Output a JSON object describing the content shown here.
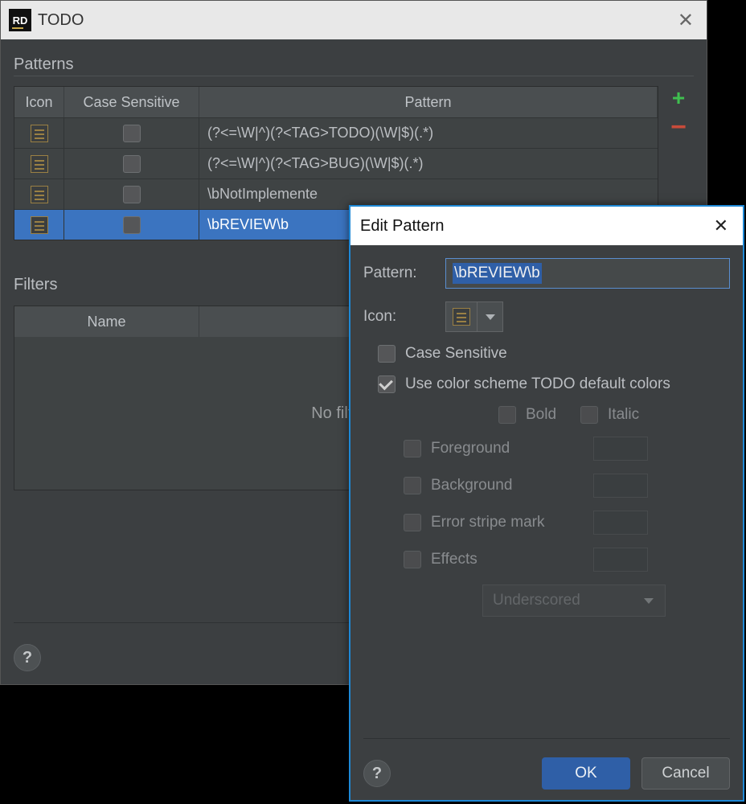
{
  "window": {
    "title": "TODO"
  },
  "patterns": {
    "section_label": "Patterns",
    "columns": {
      "icon": "Icon",
      "cs": "Case Sensitive",
      "pattern": "Pattern"
    },
    "rows": [
      {
        "pattern": "(?<=\\W|^)(?<TAG>TODO)(\\W|$)(.*)",
        "case_sensitive": false,
        "selected": false
      },
      {
        "pattern": "(?<=\\W|^)(?<TAG>BUG)(\\W|$)(.*)",
        "case_sensitive": false,
        "selected": false
      },
      {
        "pattern": "\\bNotImplemente",
        "case_sensitive": false,
        "selected": false
      },
      {
        "pattern": "\\bREVIEW\\b",
        "case_sensitive": false,
        "selected": true
      }
    ]
  },
  "filters": {
    "section_label": "Filters",
    "columns": {
      "name": "Name"
    },
    "empty_text": "No filters co"
  },
  "dialog": {
    "title": "Edit Pattern",
    "labels": {
      "pattern": "Pattern:",
      "icon": "Icon:",
      "case_sensitive": "Case Sensitive",
      "use_default": "Use color scheme TODO default colors",
      "bold": "Bold",
      "italic": "Italic",
      "foreground": "Foreground",
      "background": "Background",
      "error_stripe": "Error stripe mark",
      "effects": "Effects",
      "effects_value": "Underscored",
      "ok": "OK",
      "cancel": "Cancel"
    },
    "pattern_value": "\\bREVIEW\\b",
    "case_sensitive": false,
    "use_default": true,
    "bold": false,
    "italic": false,
    "foreground_enabled": false,
    "background_enabled": false,
    "error_stripe_enabled": false,
    "effects_enabled": false
  }
}
